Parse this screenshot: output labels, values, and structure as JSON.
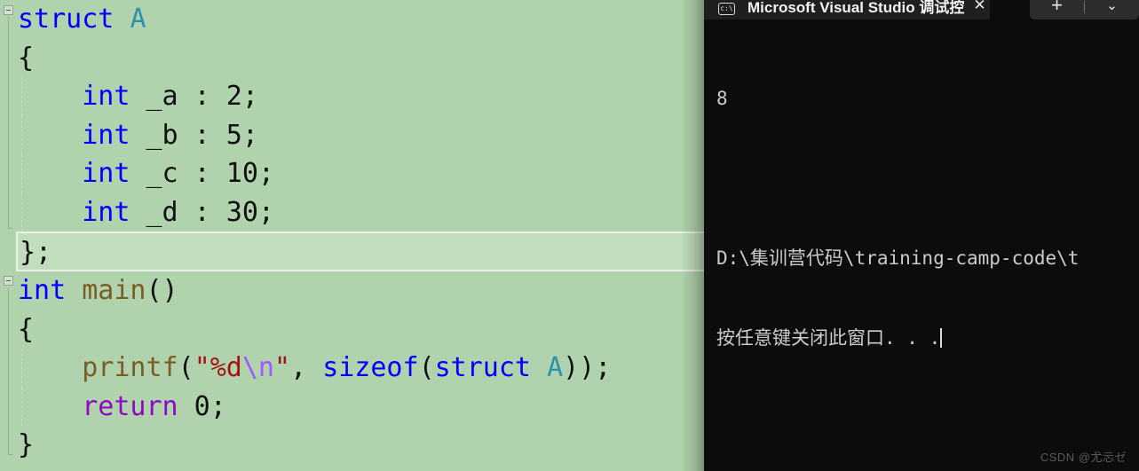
{
  "editor": {
    "background_color": "#b0d2ac",
    "lines": [
      {
        "indent": 0,
        "tokens": [
          {
            "t": "struct",
            "c": "kw"
          },
          {
            "t": " ",
            "c": "plain"
          },
          {
            "t": "A",
            "c": "type"
          }
        ]
      },
      {
        "indent": 0,
        "tokens": [
          {
            "t": "{",
            "c": "plain"
          }
        ]
      },
      {
        "indent": 1,
        "tokens": [
          {
            "t": "int",
            "c": "kw"
          },
          {
            "t": " _a : 2;",
            "c": "plain"
          }
        ]
      },
      {
        "indent": 1,
        "tokens": [
          {
            "t": "int",
            "c": "kw"
          },
          {
            "t": " _b : 5;",
            "c": "plain"
          }
        ]
      },
      {
        "indent": 1,
        "tokens": [
          {
            "t": "int",
            "c": "kw"
          },
          {
            "t": " _c : 10;",
            "c": "plain"
          }
        ]
      },
      {
        "indent": 1,
        "tokens": [
          {
            "t": "int",
            "c": "kw"
          },
          {
            "t": " _d : 30;",
            "c": "plain"
          }
        ]
      },
      {
        "indent": 0,
        "current": true,
        "tokens": [
          {
            "t": "};",
            "c": "plain"
          }
        ]
      },
      {
        "indent": 0,
        "tokens": [
          {
            "t": "int",
            "c": "kw"
          },
          {
            "t": " ",
            "c": "plain"
          },
          {
            "t": "main",
            "c": "fn"
          },
          {
            "t": "()",
            "c": "plain"
          }
        ]
      },
      {
        "indent": 0,
        "tokens": [
          {
            "t": "{",
            "c": "plain"
          }
        ]
      },
      {
        "indent": 1,
        "tokens": [
          {
            "t": "printf",
            "c": "fn"
          },
          {
            "t": "(",
            "c": "plain"
          },
          {
            "t": "\"%d",
            "c": "str"
          },
          {
            "t": "\\n",
            "c": "esc"
          },
          {
            "t": "\"",
            "c": "str"
          },
          {
            "t": ", ",
            "c": "plain"
          },
          {
            "t": "sizeof",
            "c": "kw"
          },
          {
            "t": "(",
            "c": "plain"
          },
          {
            "t": "struct",
            "c": "kw"
          },
          {
            "t": " ",
            "c": "plain"
          },
          {
            "t": "A",
            "c": "type"
          },
          {
            "t": "));",
            "c": "plain"
          }
        ]
      },
      {
        "indent": 1,
        "tokens": [
          {
            "t": "return",
            "c": "ctl"
          },
          {
            "t": " 0;",
            "c": "plain"
          }
        ]
      },
      {
        "indent": 0,
        "tokens": [
          {
            "t": "}",
            "c": "plain"
          }
        ]
      }
    ],
    "collapse_regions": [
      {
        "label": "struct-A-region",
        "line": 0
      },
      {
        "label": "main-function-region",
        "line": 7
      }
    ]
  },
  "console": {
    "background_color": "#0c0c0c",
    "tab": {
      "icon": "console-cmd-icon",
      "icon_glyph": "c:\\",
      "title": "Microsoft Visual Studio 调试控",
      "close_label": "✕"
    },
    "controls": {
      "new_tab_label": "+",
      "dropdown_label": "⌄"
    },
    "output": {
      "program_output": "8",
      "path_line": "D:\\集训营代码\\training-camp-code\\t",
      "prompt_line": "按任意键关闭此窗口. . ."
    },
    "watermark": "CSDN @尤忈ゼ"
  }
}
